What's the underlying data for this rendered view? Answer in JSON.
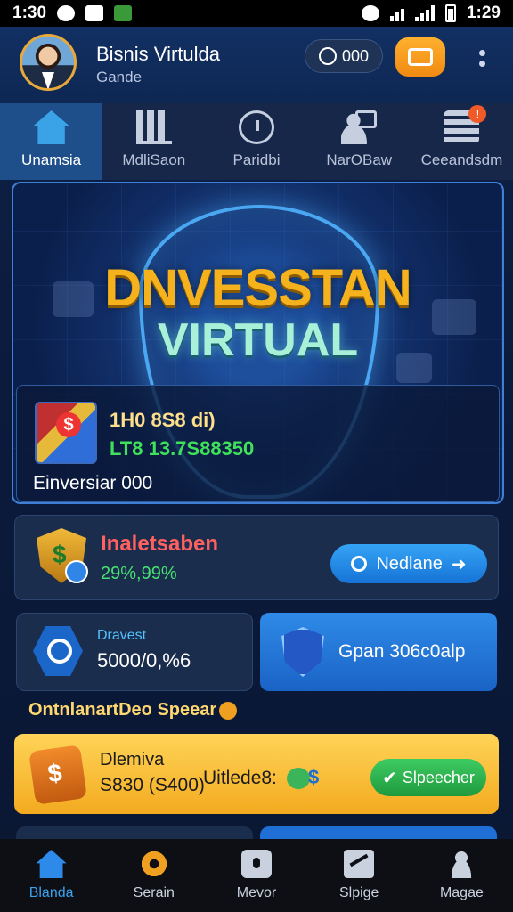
{
  "status_bar": {
    "time_left": "1:30",
    "time_right": "1:29"
  },
  "header": {
    "user_name": "Bisnis Virtulda",
    "user_role": "Gande",
    "coin_balance": "000",
    "icons": {
      "avatar": "profile-photo",
      "coin": "coin-icon",
      "wallet": "wallet-icon",
      "more": "more-vertical-icon"
    }
  },
  "tabs": [
    {
      "label": "Unamsia",
      "icon": "home-icon",
      "active": true
    },
    {
      "label": "MdliSaon",
      "icon": "building-icon",
      "active": false
    },
    {
      "label": "Paridbi",
      "icon": "clock-icon",
      "active": false
    },
    {
      "label": "NarOBaw",
      "icon": "users-icon",
      "active": false
    },
    {
      "label": "Ceeandsdm",
      "icon": "stack-icon",
      "active": false,
      "badge": "!"
    }
  ],
  "hero": {
    "title_line1": "DNVESSTAN",
    "title_line2": "VIRTUAL",
    "value_line1": "1H0 8S8 di)",
    "value_line2": "LT8 13.7S88350",
    "caption": "Einversiar 000"
  },
  "invest_card": {
    "label": "Inaletsaben",
    "percent": "29%,99%",
    "button_label": "Nedlane"
  },
  "stat_card": {
    "title": "Dravest",
    "value": "5000/0,%6"
  },
  "open_card": {
    "label": "Gpan  306c0alp"
  },
  "promo_label": "OntnlanartDeo Speear",
  "dividend_card": {
    "title": "Dlemiva",
    "amount": "S830 (S400)",
    "tag": "Uitlede8:",
    "tag_symbol": "$",
    "button_label": "Slpeecher"
  },
  "bottom_nav": [
    {
      "label": "Blanda",
      "icon": "home-icon",
      "active": true
    },
    {
      "label": "Serain",
      "icon": "gear-icon",
      "active": false
    },
    {
      "label": "Mevor",
      "icon": "lock-icon",
      "active": false
    },
    {
      "label": "Slpige",
      "icon": "share-icon",
      "active": false
    },
    {
      "label": "Magae",
      "icon": "user-icon",
      "active": false
    }
  ],
  "colors": {
    "accent_blue": "#2f8ae8",
    "accent_orange": "#f3aa1f",
    "accent_green": "#3ecb62",
    "title_gold": "#f5b21d",
    "title_mint": "#a8f0d8"
  }
}
